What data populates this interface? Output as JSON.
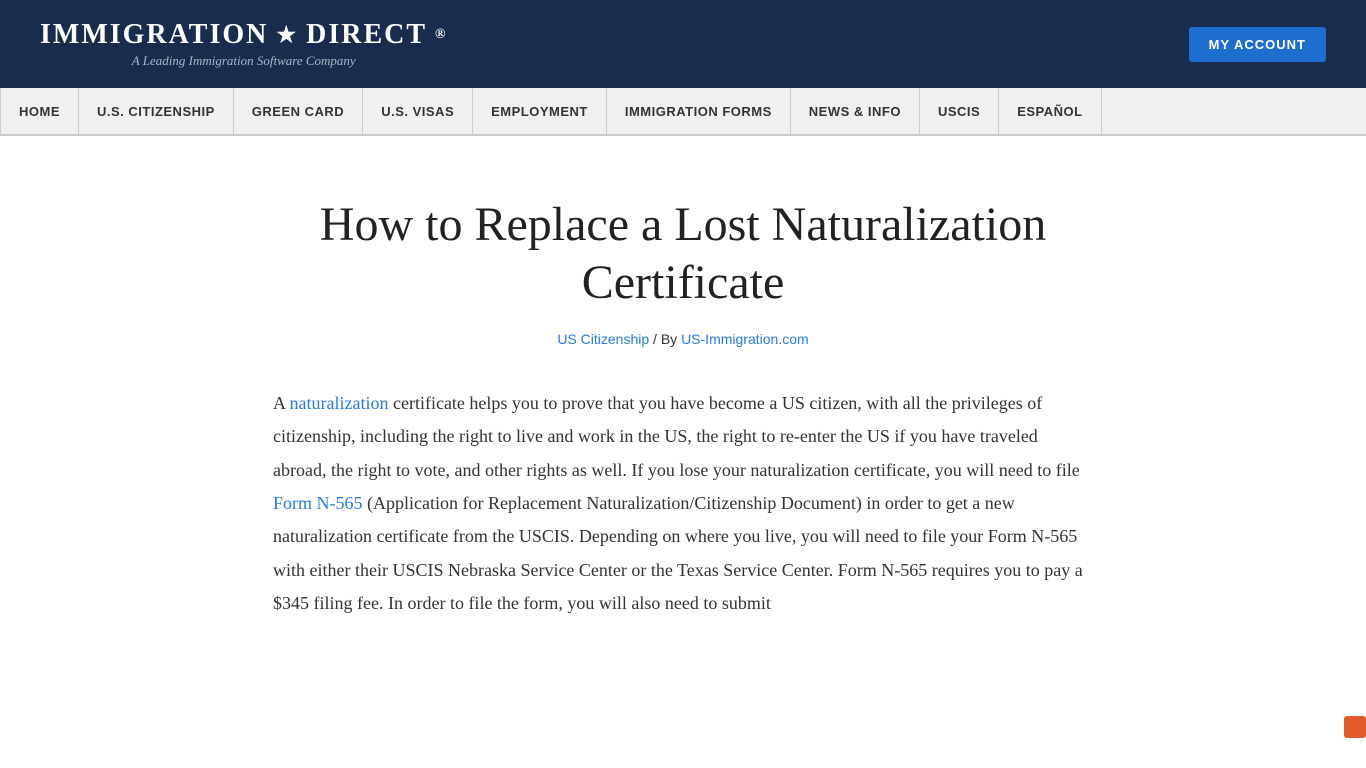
{
  "header": {
    "logo_brand": "IMMIGRATION",
    "logo_star": "★",
    "logo_direct": "DIRECT",
    "logo_registered": "®",
    "logo_tagline": "A Leading Immigration Software Company",
    "my_account_label": "MY ACCOUNT"
  },
  "nav": {
    "items": [
      {
        "label": "HOME",
        "id": "nav-home"
      },
      {
        "label": "U.S. CITIZENSHIP",
        "id": "nav-citizenship"
      },
      {
        "label": "GREEN CARD",
        "id": "nav-green-card"
      },
      {
        "label": "U.S. VISAS",
        "id": "nav-visas"
      },
      {
        "label": "EMPLOYMENT",
        "id": "nav-employment"
      },
      {
        "label": "IMMIGRATION FORMS",
        "id": "nav-forms"
      },
      {
        "label": "NEWS & INFO",
        "id": "nav-news"
      },
      {
        "label": "USCIS",
        "id": "nav-uscis"
      },
      {
        "label": "ESPAÑOL",
        "id": "nav-espanol"
      }
    ]
  },
  "article": {
    "title": "How to Replace a Lost Naturalization Certificate",
    "meta_category": "US Citizenship",
    "meta_separator": " / By ",
    "meta_author": "US-Immigration.com",
    "body_intro": "A ",
    "naturalization_link_text": "naturalization",
    "body_part1": " certificate helps you to prove that you have become a US citizen, with all the privileges of citizenship, including the right to live and work in the US, the right to re-enter the US if you have traveled abroad, the right to vote, and other rights as well. If you lose your naturalization certificate, you will need to file ",
    "form_link_text": "Form N-565",
    "body_part2": " (Application for Replacement Naturalization/Citizenship Document) in order to get a new naturalization certificate from the USCIS. Depending on where you live, you will need to file your Form N-565 with either their USCIS Nebraska Service Center or the Texas Service Center. Form N-565 requires you to pay a $345 filing fee. In order to file the form, you will also need to submit"
  }
}
